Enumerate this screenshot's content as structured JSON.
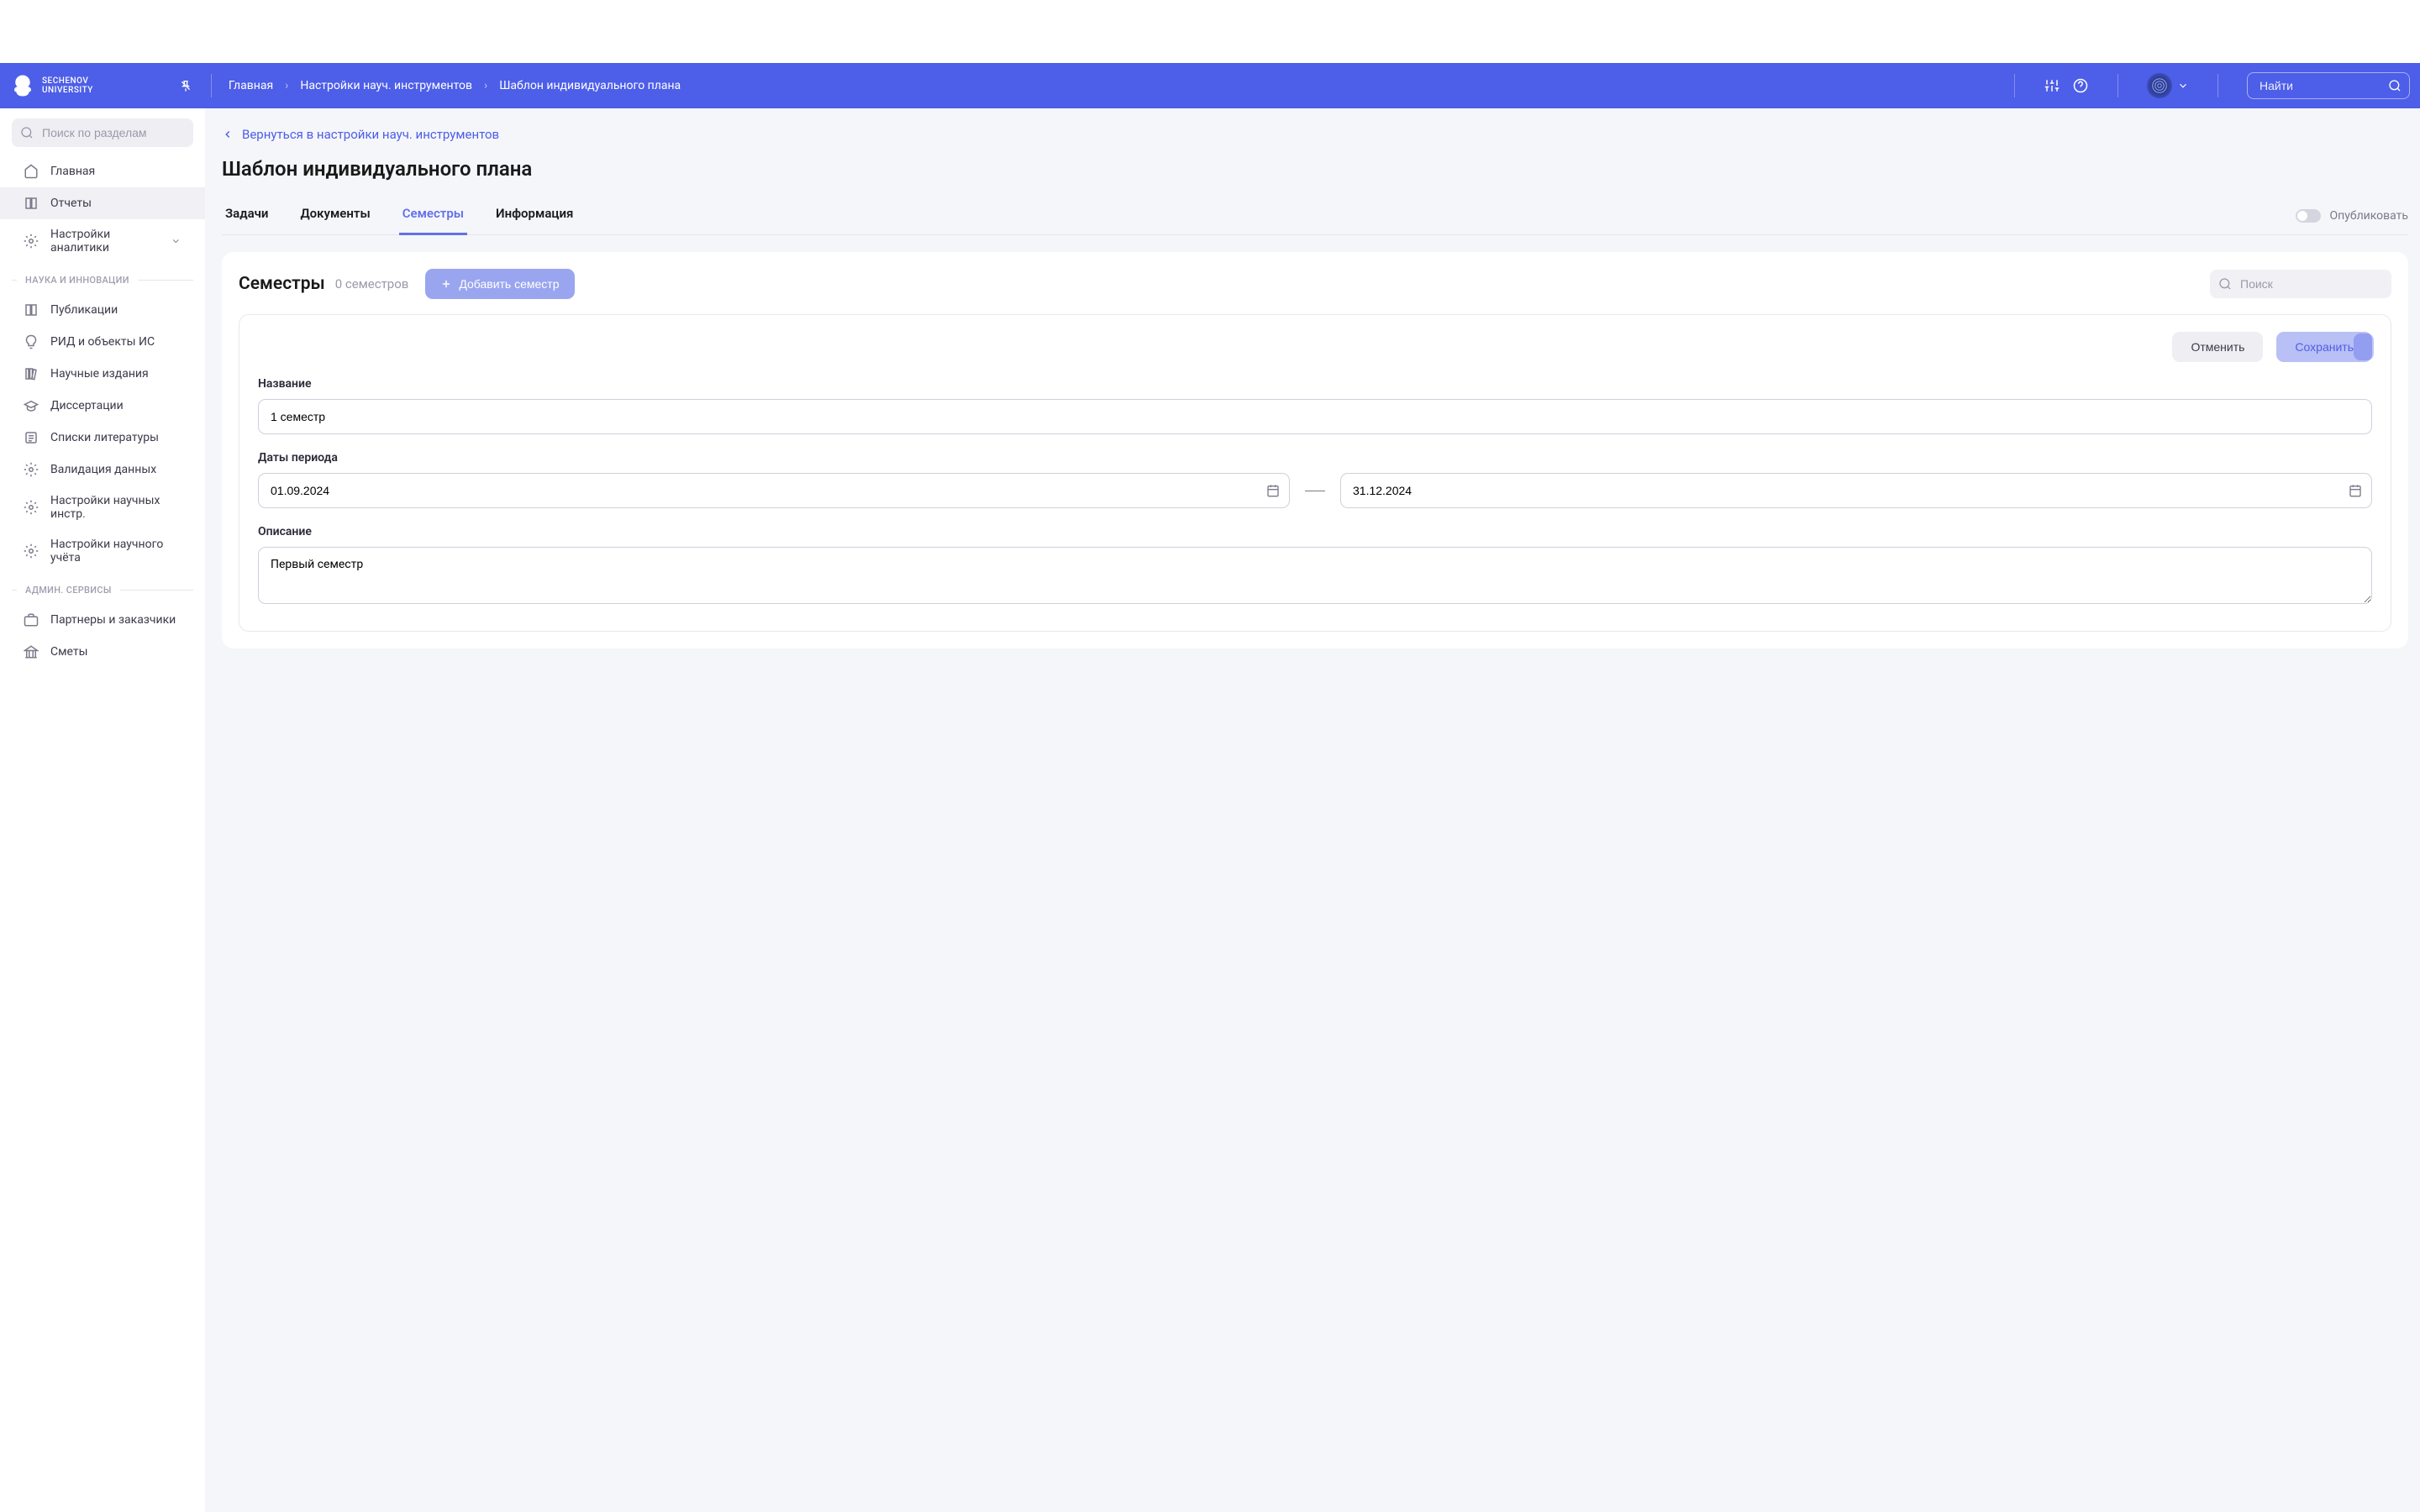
{
  "header": {
    "logo_line1": "SECHENOV",
    "logo_line2": "UNIVERSITY",
    "breadcrumbs": [
      "Главная",
      "Настройки науч. инструментов",
      "Шаблон индивидуального плана"
    ],
    "search_placeholder": "Найти"
  },
  "sidebar": {
    "search_placeholder": "Поиск по разделам",
    "items_top": [
      {
        "label": "Главная",
        "icon": "home"
      },
      {
        "label": "Отчеты",
        "icon": "book"
      },
      {
        "label": "Настройки аналитики",
        "icon": "gear",
        "expandable": true
      }
    ],
    "section1": "НАУКА И ИННОВАЦИИ",
    "items_science": [
      {
        "label": "Публикации",
        "icon": "book"
      },
      {
        "label": "РИД и объекты ИС",
        "icon": "bulb"
      },
      {
        "label": "Научные издания",
        "icon": "books"
      },
      {
        "label": "Диссертации",
        "icon": "cap"
      },
      {
        "label": "Списки литературы",
        "icon": "list"
      },
      {
        "label": "Валидация данных",
        "icon": "gear"
      },
      {
        "label": "Настройки научных инстр.",
        "icon": "gear"
      },
      {
        "label": "Настройки научного учёта",
        "icon": "gear"
      }
    ],
    "section2": "АДМИН. СЕРВИСЫ",
    "items_admin": [
      {
        "label": "Партнеры и заказчики",
        "icon": "case"
      },
      {
        "label": "Сметы",
        "icon": "bank"
      }
    ]
  },
  "main": {
    "back_link": "Вернуться в настройки науч. инструментов",
    "title": "Шаблон индивидуального плана",
    "tabs": [
      "Задачи",
      "Документы",
      "Семестры",
      "Информация"
    ],
    "active_tab_index": 2,
    "publish_label": "Опубликовать"
  },
  "card": {
    "title": "Семестры",
    "count": "0 семестров",
    "add_btn": "Добавить семестр",
    "search_placeholder": "Поиск"
  },
  "form": {
    "cancel": "Отменить",
    "save": "Сохранить",
    "name_label": "Название",
    "name_value": "1 семестр",
    "dates_label": "Даты периода",
    "date_from": "01.09.2024",
    "date_to": "31.12.2024",
    "desc_label": "Описание",
    "desc_value": "Первый семестр"
  }
}
